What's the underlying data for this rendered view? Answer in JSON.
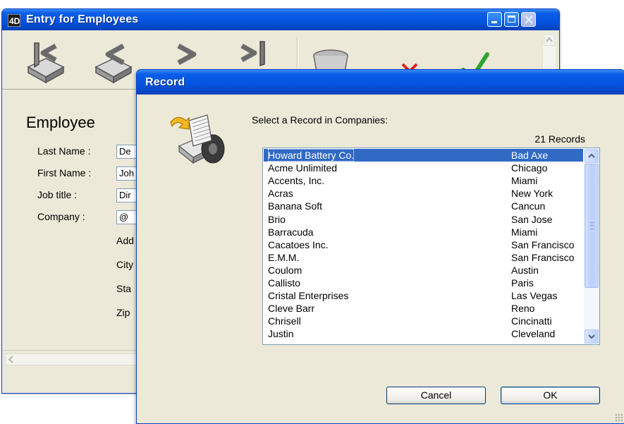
{
  "back_window": {
    "title": "Entry for Employees",
    "section_title": "Employee",
    "fields": [
      {
        "label": "Last Name :",
        "value": "De"
      },
      {
        "label": "First Name :",
        "value": "Joh"
      },
      {
        "label": "Job title :",
        "value": "Dir"
      },
      {
        "label": "Company :",
        "value": "@"
      }
    ],
    "partial_labels": [
      "Add",
      "City",
      "Sta",
      "Zip"
    ]
  },
  "dialog": {
    "title": "Record",
    "prompt": "Select a Record in Companies:",
    "count_label": "21 Records",
    "rows": [
      {
        "name": "Howard Battery Co.",
        "city": "Bad Axe"
      },
      {
        "name": "Acme Unlimited",
        "city": "Chicago"
      },
      {
        "name": "Accents, Inc.",
        "city": "Miami"
      },
      {
        "name": "Acras",
        "city": "New York"
      },
      {
        "name": "Banana Soft",
        "city": "Cancun"
      },
      {
        "name": "Brio",
        "city": "San Jose"
      },
      {
        "name": "Barracuda",
        "city": "Miami"
      },
      {
        "name": "Cacatoes Inc.",
        "city": "San Francisco"
      },
      {
        "name": "E.M.M.",
        "city": "San Francisco"
      },
      {
        "name": "Coulom",
        "city": "Austin"
      },
      {
        "name": "Callisto",
        "city": "Paris"
      },
      {
        "name": "Cristal Enterprises",
        "city": "Las Vegas"
      },
      {
        "name": "Cleve Barr",
        "city": "Reno"
      },
      {
        "name": "Chrisell",
        "city": "Cincinatti"
      },
      {
        "name": "Justin",
        "city": "Cleveland"
      }
    ],
    "selected_index": 0,
    "cancel_label": "Cancel",
    "ok_label": "OK"
  },
  "icons": {
    "app": "4d-app-icon",
    "first_record": "first-record-icon",
    "previous_record": "previous-record-icon",
    "next_record": "next-record-icon",
    "last_record": "last-record-icon",
    "delete": "trash-icon",
    "cancel": "cancel-x-icon",
    "accept": "accept-check-icon",
    "dialog": "record-select-icon"
  },
  "colors": {
    "titlebar": "#0553df",
    "selection": "#316ac5",
    "window_bg": "#ece9d8"
  }
}
